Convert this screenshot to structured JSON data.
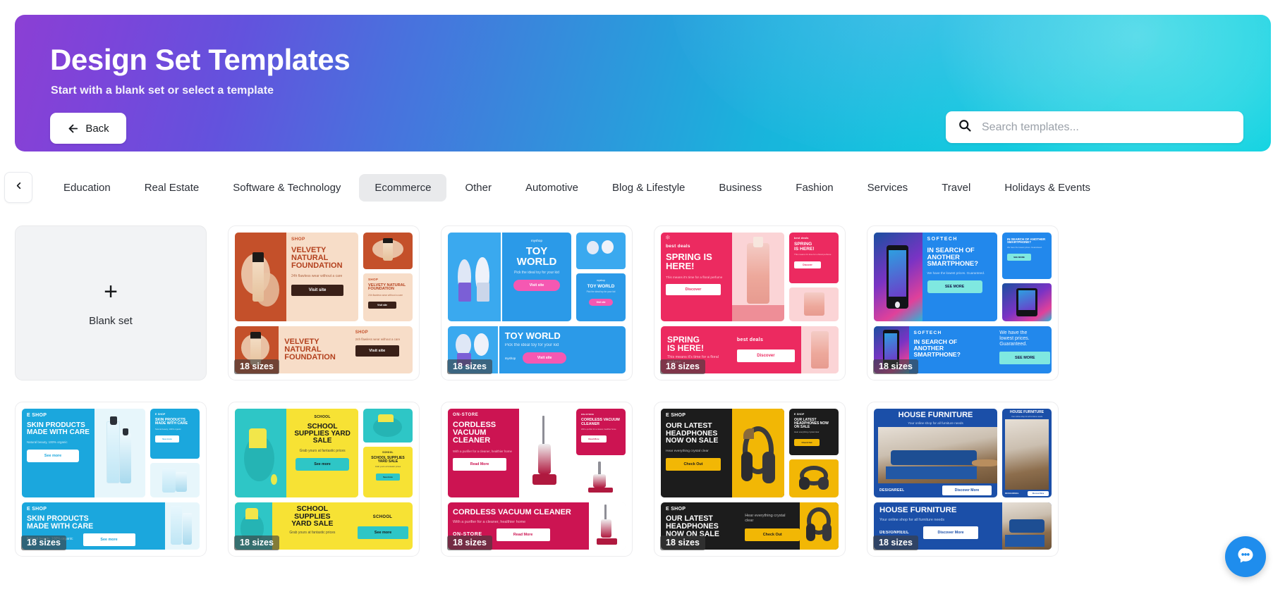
{
  "hero": {
    "title": "Design Set Templates",
    "subtitle": "Start with a blank set or select a template",
    "back_label": "Back",
    "back_icon": "arrow-left-icon",
    "gradient_from": "#8b3fd4",
    "gradient_to": "#16d4e2"
  },
  "search": {
    "placeholder": "Search templates...",
    "value": "",
    "icon": "search-icon"
  },
  "tabs": {
    "prev_icon": "chevron-left-icon",
    "active": "Ecommerce",
    "items": [
      {
        "label": "Education"
      },
      {
        "label": "Real Estate"
      },
      {
        "label": "Software & Technology"
      },
      {
        "label": "Ecommerce"
      },
      {
        "label": "Other"
      },
      {
        "label": "Automotive"
      },
      {
        "label": "Blog & Lifestyle"
      },
      {
        "label": "Business"
      },
      {
        "label": "Fashion"
      },
      {
        "label": "Services"
      },
      {
        "label": "Travel"
      },
      {
        "label": "Holidays & Events"
      }
    ]
  },
  "blank_card": {
    "label": "Blank set",
    "icon": "plus-icon"
  },
  "templates": [
    {
      "name": "velvety-natural-foundation",
      "sizes_badge": "18 sizes",
      "brand": "SHOP",
      "headline": "VELVETY NATURAL FOUNDATION",
      "body": "24h flawless wear without a care",
      "cta": "Visit site",
      "colors": {
        "primary": "#c4502a",
        "secondary": "#f7ddc8",
        "text": "#ffffff",
        "button": "#3a2018"
      }
    },
    {
      "name": "toy-world",
      "sizes_badge": "18 sizes",
      "brand": "myshop",
      "headline": "TOY WORLD",
      "body": "Pick the ideal toy for your kid",
      "cta": "Visit site",
      "colors": {
        "primary": "#2b9ae8",
        "secondary": "#3aa9ef",
        "text": "#ffffff",
        "button": "#f558b2"
      }
    },
    {
      "name": "spring-is-here",
      "sizes_badge": "18 sizes",
      "brand": "best deals",
      "headline": "SPRING IS HERE!",
      "body": "This means it's time for a floral perfume",
      "cta": "Discover",
      "colors": {
        "primary": "#ec2a60",
        "secondary": "#fbd4d6",
        "text": "#ffffff",
        "button": "#ffffff"
      }
    },
    {
      "name": "softech-smartphone",
      "sizes_badge": "18 sizes",
      "brand": "SOFTECH",
      "headline": "IN SEARCH OF ANOTHER SMARTPHONE?",
      "body": "We have the lowest prices. Guaranteed.",
      "cta": "SEE MORE",
      "colors": {
        "primary": "#2288ec",
        "secondary": "#1a7ada",
        "text": "#ffffff",
        "button": "#7fe8e0"
      }
    },
    {
      "name": "skin-products",
      "sizes_badge": "18 sizes",
      "brand": "E SHOP",
      "headline": "SKIN PRODUCTS MADE WITH CARE",
      "body": "Natural beauty, 100% organic",
      "cta": "See more",
      "colors": {
        "primary": "#1ba7dd",
        "secondary": "#e7f6fb",
        "text": "#ffffff",
        "button": "#ffffff"
      }
    },
    {
      "name": "school-supplies-yard-sale",
      "sizes_badge": "18 sizes",
      "brand": "SCHOOL",
      "headline": "SCHOOL SUPPLIES YARD SALE",
      "body": "Grab yours at fantastic prices",
      "cta": "See more",
      "colors": {
        "primary": "#f7e234",
        "secondary": "#2ec6c6",
        "text": "#16181b",
        "button": "#2ec6c6"
      }
    },
    {
      "name": "cordless-vacuum-cleaner",
      "sizes_badge": "18 sizes",
      "brand": "ON-STORE",
      "headline": "CORDLESS VACUUM CLEANER",
      "body": "With a purifier for a cleaner, healthier home",
      "cta": "Read More",
      "colors": {
        "primary": "#cc1452",
        "secondary": "#f5f2f3",
        "text": "#ffffff",
        "button": "#ffffff"
      }
    },
    {
      "name": "latest-headphones",
      "sizes_badge": "18 sizes",
      "brand": "E SHOP",
      "headline": "OUR LATEST HEADPHONES NOW ON SALE",
      "body": "Hear everything crystal clear",
      "cta": "Check Out",
      "colors": {
        "primary": "#1c1c1c",
        "secondary": "#f2b705",
        "text": "#ffffff",
        "button": "#f2b705"
      }
    },
    {
      "name": "house-furniture",
      "sizes_badge": "18 sizes",
      "brand": "DESIGNREEL",
      "headline": "HOUSE FURNITURE",
      "body": "Your online shop for all furniture needs",
      "cta": "Discover More",
      "colors": {
        "primary": "#1b4fa8",
        "secondary": "#ffffff",
        "text": "#ffffff",
        "button": "#ffffff"
      }
    }
  ],
  "support": {
    "icon": "chat-bubble-icon",
    "color": "#1f8ded"
  }
}
